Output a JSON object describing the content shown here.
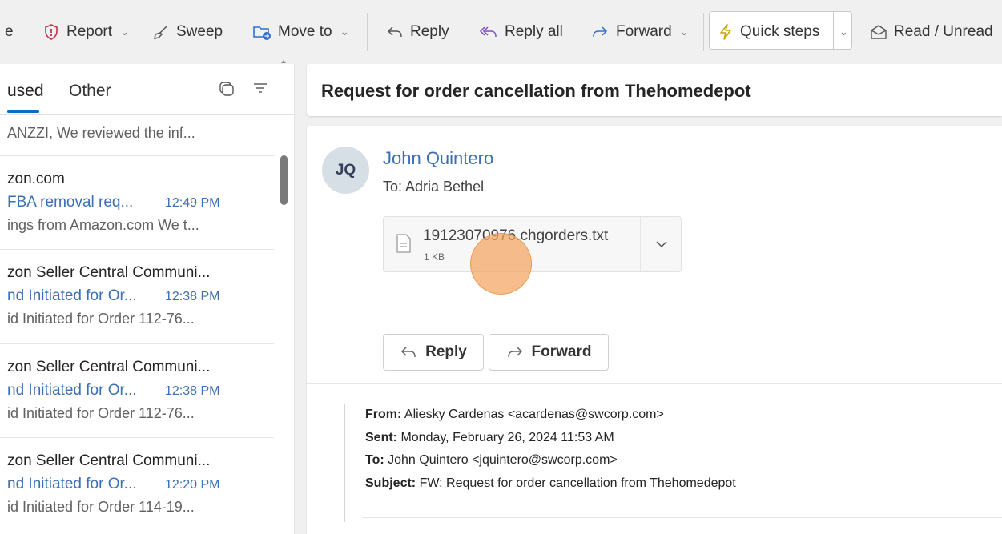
{
  "ribbon": {
    "partial_left": "e",
    "report": "Report",
    "sweep": "Sweep",
    "move_to": "Move to",
    "reply": "Reply",
    "reply_all": "Reply all",
    "forward": "Forward",
    "quick_steps": "Quick steps",
    "read_unread": "Read / Unread"
  },
  "list": {
    "tab_focused": "used",
    "tab_other": "Other",
    "messages": [
      {
        "preview": "ANZZI, We reviewed the inf..."
      },
      {
        "sender": "zon.com",
        "subject": "FBA removal req...",
        "time": "12:49 PM",
        "preview": "ings from Amazon.com We t..."
      },
      {
        "sender": "zon Seller Central Communi...",
        "subject": "nd Initiated for Or...",
        "time": "12:38 PM",
        "preview": "id Initiated for Order 112-76..."
      },
      {
        "sender": "zon Seller Central Communi...",
        "subject": "nd Initiated for Or...",
        "time": "12:38 PM",
        "preview": "id Initiated for Order 112-76..."
      },
      {
        "sender": "zon Seller Central Communi...",
        "subject": "nd Initiated for Or...",
        "time": "12:20 PM",
        "preview": "id Initiated for Order 114-19..."
      }
    ]
  },
  "reading": {
    "subject": "Request for order cancellation from Thehomedepot",
    "avatar_initials": "JQ",
    "from_name": "John Quintero",
    "to_line": "To:  Adria Bethel",
    "attachment": {
      "name": "19123070976.chgorders.txt",
      "size": "1 KB"
    },
    "reply_button": "Reply",
    "forward_button": "Forward",
    "quoted": {
      "from_label": "From:",
      "from_value": " Aliesky Cardenas <acardenas@swcorp.com>",
      "sent_label": "Sent:",
      "sent_value": " Monday, February 26, 2024 11:53 AM",
      "to_label": "To:",
      "to_value": " John Quintero <jquintero@swcorp.com>",
      "subject_label": "Subject:",
      "subject_value": " FW: Request for order cancellation from Thehomedepot"
    }
  },
  "colors": {
    "accent_blue": "#3b6fb6",
    "report_red": "#c4314b",
    "moveto_blue": "#2f6fd0",
    "quick_steps_yellow": "#c8a100",
    "cursor_orange": "#f4a460"
  }
}
